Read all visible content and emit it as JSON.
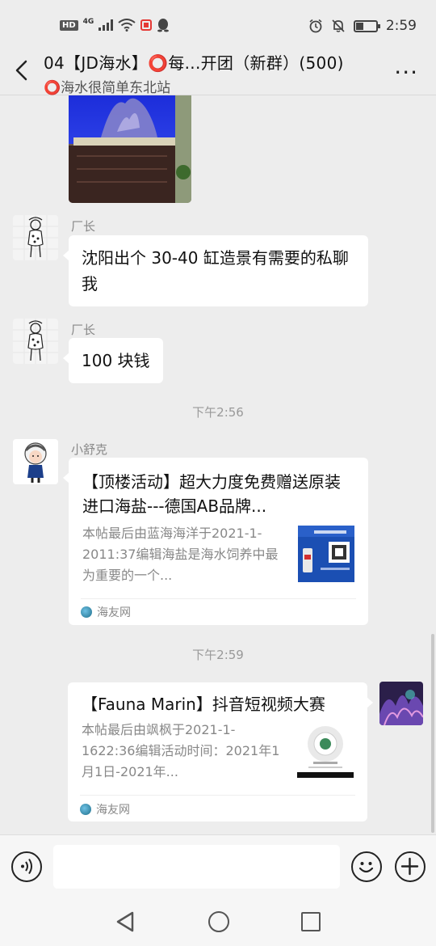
{
  "status_bar": {
    "hd": "HD",
    "network": "4G",
    "time": "2:59"
  },
  "header": {
    "title": "04【JD海水】⭕每...开团（新群）(500)",
    "subtitle": "⭕海水很简单东北站",
    "more": "..."
  },
  "messages": [
    {
      "sender": "厂长",
      "text": "沈阳出个 30-40 缸造景有需要的私聊我"
    },
    {
      "sender": "厂长",
      "text": "100 块钱"
    }
  ],
  "timestamps": [
    "下午2:56",
    "下午2:59"
  ],
  "cards": [
    {
      "sender": "小舒克",
      "title": "【顶楼活动】超大力度免费赠送原装进口海盐---德国AB品牌...",
      "desc": "本帖最后由蓝海海洋于2021-1-2011:37编辑海盐是海水饲养中最为重要的一个...",
      "source": "海友网"
    },
    {
      "title": "【Fauna Marin】抖音短视频大赛",
      "desc": "本帖最后由飒枫于2021-1-1622:36编辑活动时间：2021年1月1日-2021年...",
      "source": "海友网"
    }
  ],
  "colors": {
    "background": "#ededed",
    "bubble": "#ffffff",
    "accent_red": "#e53935"
  },
  "icons": {
    "back": "chevron-left-icon",
    "voice": "voice-icon",
    "emoji": "emoji-icon",
    "plus": "plus-icon"
  }
}
